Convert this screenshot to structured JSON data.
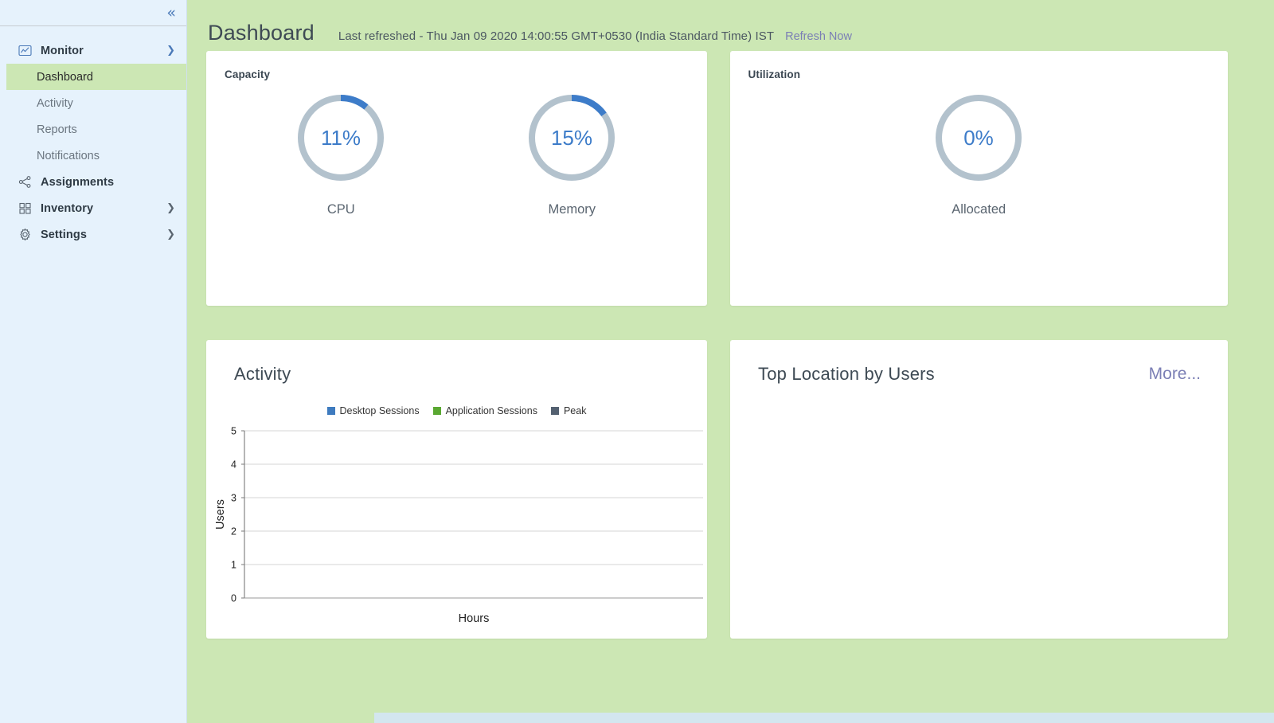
{
  "sidebar": {
    "collapse_icon": "chevron-double-left-icon",
    "groups": [
      {
        "label": "Monitor",
        "icon": "monitor-chart-icon",
        "chevron": "chevron-down-icon",
        "children": [
          {
            "label": "Dashboard",
            "active": true
          },
          {
            "label": "Activity",
            "active": false
          },
          {
            "label": "Reports",
            "active": false
          },
          {
            "label": "Notifications",
            "active": false
          }
        ]
      },
      {
        "label": "Assignments",
        "icon": "share-nodes-icon",
        "chevron": ""
      },
      {
        "label": "Inventory",
        "icon": "grid-squares-icon",
        "chevron": "chevron-right-icon"
      },
      {
        "label": "Settings",
        "icon": "gear-icon",
        "chevron": "chevron-right-icon"
      }
    ]
  },
  "header": {
    "title": "Dashboard",
    "last_refreshed": "Last refreshed - Thu Jan 09 2020 14:00:55 GMT+0530 (India Standard Time) IST",
    "refresh_link": "Refresh Now"
  },
  "capacity": {
    "subtitle": "Capacity",
    "gauges": [
      {
        "label": "CPU",
        "value": "11%",
        "percent": 11
      },
      {
        "label": "Memory",
        "value": "15%",
        "percent": 15
      }
    ]
  },
  "utilization": {
    "subtitle": "Utilization",
    "gauges": [
      {
        "label": "Allocated",
        "value": "0%",
        "percent": 0
      }
    ]
  },
  "activity": {
    "title": "Activity"
  },
  "top_location": {
    "title": "Top Location by Users",
    "more_label": "More..."
  },
  "colors": {
    "page_background": "#cce7b4",
    "sidebar_background": "#e6f2fc",
    "card_background": "#ffffff",
    "accent_blue": "#3d7cc9",
    "gauge_track": "#b3c2cd",
    "link_purple": "#7b7fb5",
    "series_desktop": "#3e7bbf",
    "series_application": "#5aa832",
    "series_peak": "#546171",
    "scrollbar_track": "#d3e6ef"
  },
  "chart_data": {
    "type": "line",
    "title": "Activity",
    "xlabel": "Hours",
    "ylabel": "Users",
    "ylim": [
      0,
      5
    ],
    "yticks": [
      0,
      1,
      2,
      3,
      4,
      5
    ],
    "x": [],
    "grid": true,
    "legend_position": "top",
    "series": [
      {
        "name": "Desktop Sessions",
        "color": "#3e7bbf",
        "values": []
      },
      {
        "name": "Application Sessions",
        "color": "#5aa832",
        "values": []
      },
      {
        "name": "Peak",
        "color": "#546171",
        "values": []
      }
    ]
  }
}
